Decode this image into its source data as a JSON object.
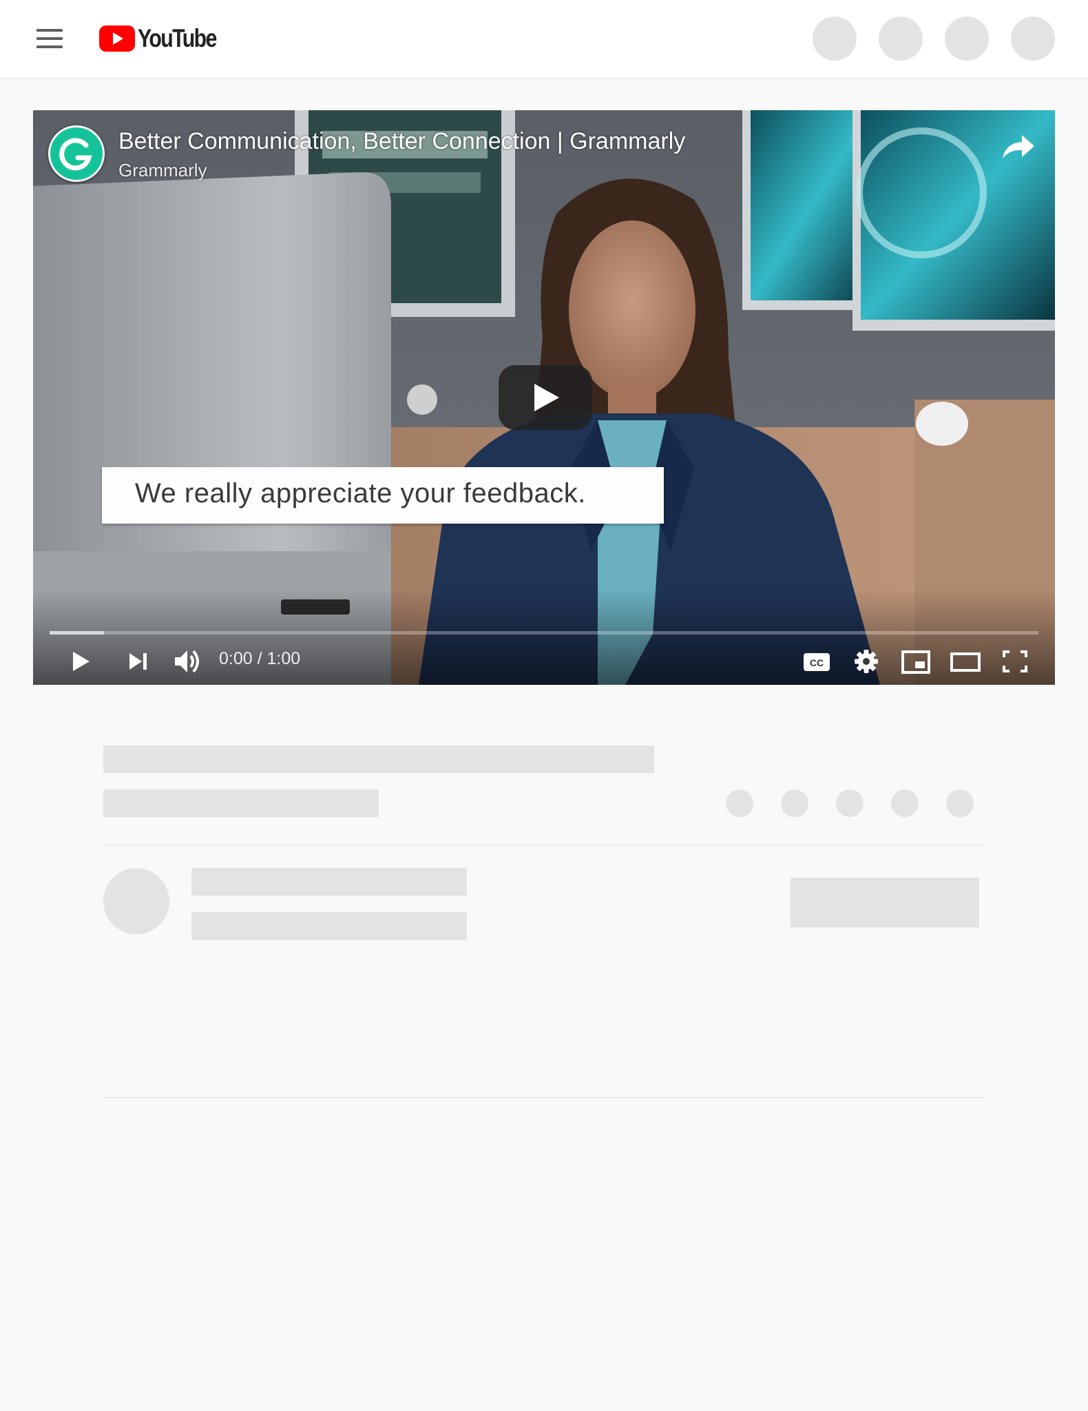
{
  "header": {
    "logo_text": "YouTube",
    "icons": [
      "menu-icon",
      "youtube-logo-icon"
    ],
    "brand_color": "#ff0000"
  },
  "player": {
    "title": "Better Communication, Better Connection | Grammarly",
    "channel": "Grammarly",
    "caption": "We really appreciate your feedback.",
    "time": "0:00 / 1:00",
    "progress_loaded_fraction": 0.055,
    "controls": [
      "play-icon",
      "next-icon",
      "volume-icon",
      "cc-icon",
      "settings-icon",
      "miniplayer-icon",
      "theater-icon",
      "fullscreen-icon"
    ],
    "channel_color": "#15c39a"
  }
}
